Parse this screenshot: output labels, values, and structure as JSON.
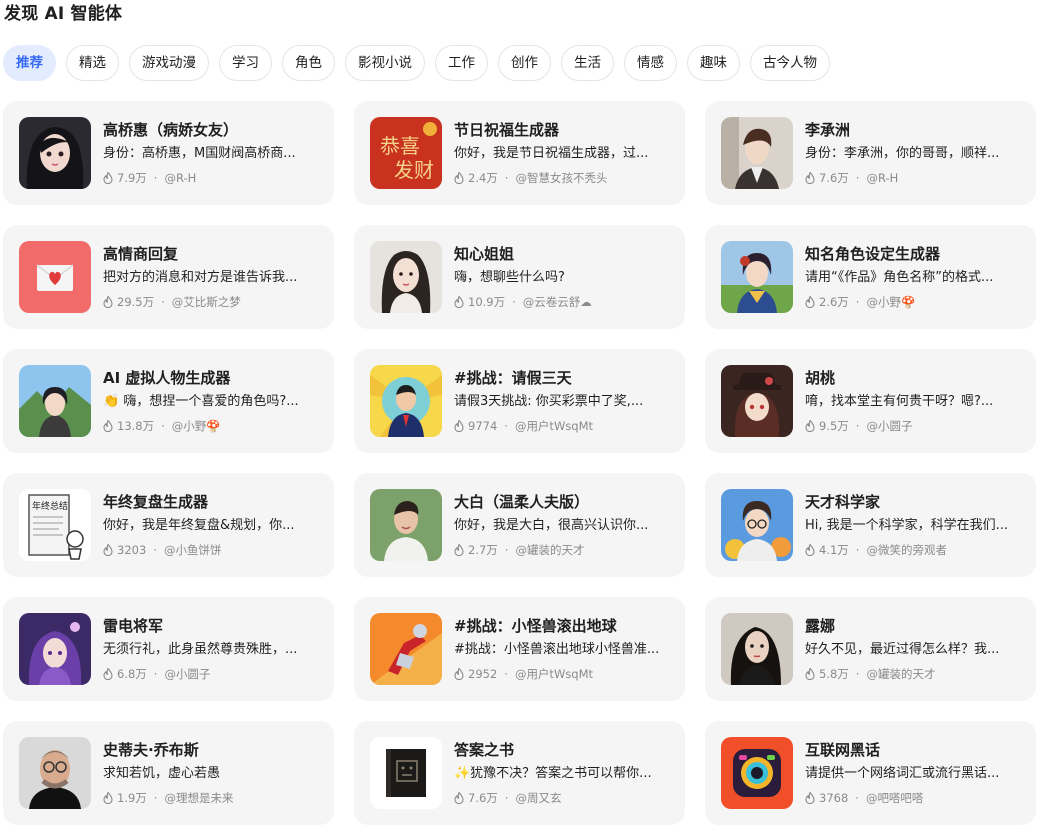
{
  "page_title": "发现 AI 智能体",
  "tabs": [
    {
      "label": "推荐",
      "active": true
    },
    {
      "label": "精选"
    },
    {
      "label": "游戏动漫"
    },
    {
      "label": "学习"
    },
    {
      "label": "角色"
    },
    {
      "label": "影视小说"
    },
    {
      "label": "工作"
    },
    {
      "label": "创作"
    },
    {
      "label": "生活"
    },
    {
      "label": "情感"
    },
    {
      "label": "趣味"
    },
    {
      "label": "古今人物"
    }
  ],
  "colors": {
    "accent": "#3b6cf6",
    "active_tab_bg": "#e3ecff",
    "card_bg": "#f5f5f5",
    "meta_text": "#8a8a8a"
  },
  "agents": [
    {
      "name": "高桥惠（病娇女友）",
      "desc": "身份：高桥惠，M国财阀高桥商...",
      "count": "7.9万",
      "author": "@R-H",
      "avatar": "anime-girl-dark-hair"
    },
    {
      "name": "节日祝福生成器",
      "desc": "你好，我是节日祝福生成器，过...",
      "count": "2.4万",
      "author": "@智慧女孩不秃头",
      "avatar": "red-greeting-card"
    },
    {
      "name": "李承洲",
      "desc": "身份：李承洲，你的哥哥，顺祥...",
      "count": "7.6万",
      "author": "@R-H",
      "avatar": "anime-man-suit"
    },
    {
      "name": "高情商回复",
      "desc": "把对方的消息和对方是谁告诉我...",
      "count": "29.5万",
      "author": "@艾比斯之梦",
      "avatar": "love-letter-icon"
    },
    {
      "name": "知心姐姐",
      "desc": "嗨，想聊些什么吗?",
      "count": "10.9万",
      "author": "@云卷云舒☁",
      "avatar": "woman-portrait"
    },
    {
      "name": "知名角色设定生成器",
      "desc": "请用“《作品》角色名称”的格式...",
      "count": "2.6万",
      "author": "@小野🍄",
      "avatar": "anime-girl-stadium"
    },
    {
      "name": "AI 虚拟人物生成器",
      "desc": "👏 嗨，想捏一个喜爱的角色吗?...",
      "count": "13.8万",
      "author": "@小野🍄",
      "avatar": "anime-girl-landscape"
    },
    {
      "name": "#挑战：请假三天",
      "desc": "请假3天挑战: 你买彩票中了奖,...",
      "count": "9774",
      "author": "@用户tWsqMt",
      "avatar": "cartoon-boss"
    },
    {
      "name": "胡桃",
      "desc": "唷，找本堂主有何贵干呀？嗯?...",
      "count": "9.5万",
      "author": "@小圆子",
      "avatar": "anime-girl-hat"
    },
    {
      "name": "年终复盘生成器",
      "desc": "你好，我是年终复盘&规划，你...",
      "count": "3203",
      "author": "@小鱼饼饼",
      "avatar": "year-end-sketch"
    },
    {
      "name": "大白（温柔人夫版）",
      "desc": "你好，我是大白，很高兴认识你...",
      "count": "2.7万",
      "author": "@罐装的天才",
      "avatar": "man-portrait"
    },
    {
      "name": "天才科学家",
      "desc": "Hi, 我是一个科学家，科学在我们...",
      "count": "4.1万",
      "author": "@微笑的旁观者",
      "avatar": "anime-boy-glasses"
    },
    {
      "name": "雷电将军",
      "desc": "无须行礼，此身虽然尊贵殊胜，...",
      "count": "6.8万",
      "author": "@小圆子",
      "avatar": "anime-purple-hair"
    },
    {
      "name": "#挑战：小怪兽滚出地球",
      "desc": "#挑战：小怪兽滚出地球小怪兽准...",
      "count": "2952",
      "author": "@用户tWsqMt",
      "avatar": "hero-action"
    },
    {
      "name": "露娜",
      "desc": "好久不见，最近过得怎么样？我...",
      "count": "5.8万",
      "author": "@罐装的天才",
      "avatar": "woman-dark-hair"
    },
    {
      "name": "史蒂夫·乔布斯",
      "desc": "求知若饥，虚心若愚",
      "count": "1.9万",
      "author": "@理想是未来",
      "avatar": "man-glasses-portrait"
    },
    {
      "name": "答案之书",
      "desc": "✨犹豫不决？答案之书可以帮你...",
      "count": "7.6万",
      "author": "@周又玄",
      "avatar": "black-book"
    },
    {
      "name": "互联网黑话",
      "desc": "请提供一个网络词汇或流行黑话...",
      "count": "3768",
      "author": "@吧嗒吧嗒",
      "avatar": "colorful-camera-icon"
    }
  ]
}
